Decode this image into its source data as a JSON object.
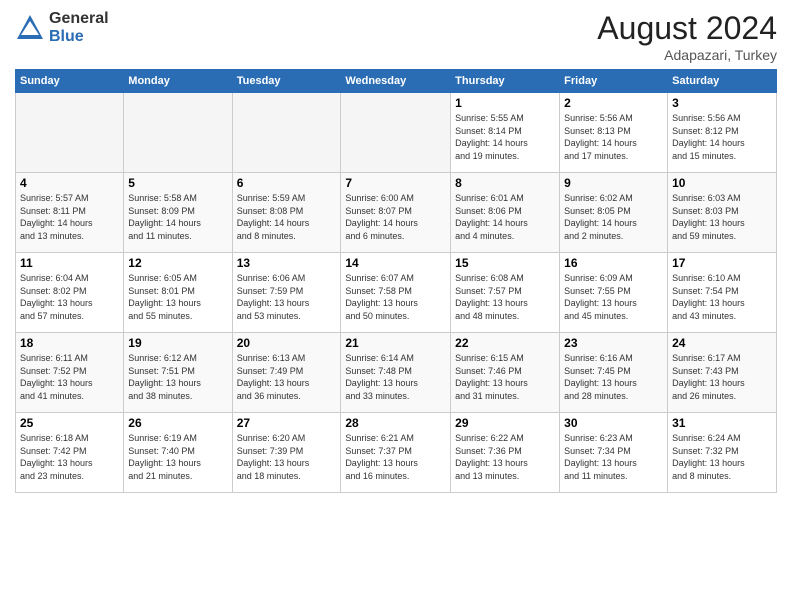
{
  "logo": {
    "general": "General",
    "blue": "Blue"
  },
  "title": "August 2024",
  "location": "Adapazari, Turkey",
  "headers": [
    "Sunday",
    "Monday",
    "Tuesday",
    "Wednesday",
    "Thursday",
    "Friday",
    "Saturday"
  ],
  "weeks": [
    [
      {
        "day": "",
        "info": ""
      },
      {
        "day": "",
        "info": ""
      },
      {
        "day": "",
        "info": ""
      },
      {
        "day": "",
        "info": ""
      },
      {
        "day": "1",
        "info": "Sunrise: 5:55 AM\nSunset: 8:14 PM\nDaylight: 14 hours\nand 19 minutes."
      },
      {
        "day": "2",
        "info": "Sunrise: 5:56 AM\nSunset: 8:13 PM\nDaylight: 14 hours\nand 17 minutes."
      },
      {
        "day": "3",
        "info": "Sunrise: 5:56 AM\nSunset: 8:12 PM\nDaylight: 14 hours\nand 15 minutes."
      }
    ],
    [
      {
        "day": "4",
        "info": "Sunrise: 5:57 AM\nSunset: 8:11 PM\nDaylight: 14 hours\nand 13 minutes."
      },
      {
        "day": "5",
        "info": "Sunrise: 5:58 AM\nSunset: 8:09 PM\nDaylight: 14 hours\nand 11 minutes."
      },
      {
        "day": "6",
        "info": "Sunrise: 5:59 AM\nSunset: 8:08 PM\nDaylight: 14 hours\nand 8 minutes."
      },
      {
        "day": "7",
        "info": "Sunrise: 6:00 AM\nSunset: 8:07 PM\nDaylight: 14 hours\nand 6 minutes."
      },
      {
        "day": "8",
        "info": "Sunrise: 6:01 AM\nSunset: 8:06 PM\nDaylight: 14 hours\nand 4 minutes."
      },
      {
        "day": "9",
        "info": "Sunrise: 6:02 AM\nSunset: 8:05 PM\nDaylight: 14 hours\nand 2 minutes."
      },
      {
        "day": "10",
        "info": "Sunrise: 6:03 AM\nSunset: 8:03 PM\nDaylight: 13 hours\nand 59 minutes."
      }
    ],
    [
      {
        "day": "11",
        "info": "Sunrise: 6:04 AM\nSunset: 8:02 PM\nDaylight: 13 hours\nand 57 minutes."
      },
      {
        "day": "12",
        "info": "Sunrise: 6:05 AM\nSunset: 8:01 PM\nDaylight: 13 hours\nand 55 minutes."
      },
      {
        "day": "13",
        "info": "Sunrise: 6:06 AM\nSunset: 7:59 PM\nDaylight: 13 hours\nand 53 minutes."
      },
      {
        "day": "14",
        "info": "Sunrise: 6:07 AM\nSunset: 7:58 PM\nDaylight: 13 hours\nand 50 minutes."
      },
      {
        "day": "15",
        "info": "Sunrise: 6:08 AM\nSunset: 7:57 PM\nDaylight: 13 hours\nand 48 minutes."
      },
      {
        "day": "16",
        "info": "Sunrise: 6:09 AM\nSunset: 7:55 PM\nDaylight: 13 hours\nand 45 minutes."
      },
      {
        "day": "17",
        "info": "Sunrise: 6:10 AM\nSunset: 7:54 PM\nDaylight: 13 hours\nand 43 minutes."
      }
    ],
    [
      {
        "day": "18",
        "info": "Sunrise: 6:11 AM\nSunset: 7:52 PM\nDaylight: 13 hours\nand 41 minutes."
      },
      {
        "day": "19",
        "info": "Sunrise: 6:12 AM\nSunset: 7:51 PM\nDaylight: 13 hours\nand 38 minutes."
      },
      {
        "day": "20",
        "info": "Sunrise: 6:13 AM\nSunset: 7:49 PM\nDaylight: 13 hours\nand 36 minutes."
      },
      {
        "day": "21",
        "info": "Sunrise: 6:14 AM\nSunset: 7:48 PM\nDaylight: 13 hours\nand 33 minutes."
      },
      {
        "day": "22",
        "info": "Sunrise: 6:15 AM\nSunset: 7:46 PM\nDaylight: 13 hours\nand 31 minutes."
      },
      {
        "day": "23",
        "info": "Sunrise: 6:16 AM\nSunset: 7:45 PM\nDaylight: 13 hours\nand 28 minutes."
      },
      {
        "day": "24",
        "info": "Sunrise: 6:17 AM\nSunset: 7:43 PM\nDaylight: 13 hours\nand 26 minutes."
      }
    ],
    [
      {
        "day": "25",
        "info": "Sunrise: 6:18 AM\nSunset: 7:42 PM\nDaylight: 13 hours\nand 23 minutes."
      },
      {
        "day": "26",
        "info": "Sunrise: 6:19 AM\nSunset: 7:40 PM\nDaylight: 13 hours\nand 21 minutes."
      },
      {
        "day": "27",
        "info": "Sunrise: 6:20 AM\nSunset: 7:39 PM\nDaylight: 13 hours\nand 18 minutes."
      },
      {
        "day": "28",
        "info": "Sunrise: 6:21 AM\nSunset: 7:37 PM\nDaylight: 13 hours\nand 16 minutes."
      },
      {
        "day": "29",
        "info": "Sunrise: 6:22 AM\nSunset: 7:36 PM\nDaylight: 13 hours\nand 13 minutes."
      },
      {
        "day": "30",
        "info": "Sunrise: 6:23 AM\nSunset: 7:34 PM\nDaylight: 13 hours\nand 11 minutes."
      },
      {
        "day": "31",
        "info": "Sunrise: 6:24 AM\nSunset: 7:32 PM\nDaylight: 13 hours\nand 8 minutes."
      }
    ]
  ]
}
